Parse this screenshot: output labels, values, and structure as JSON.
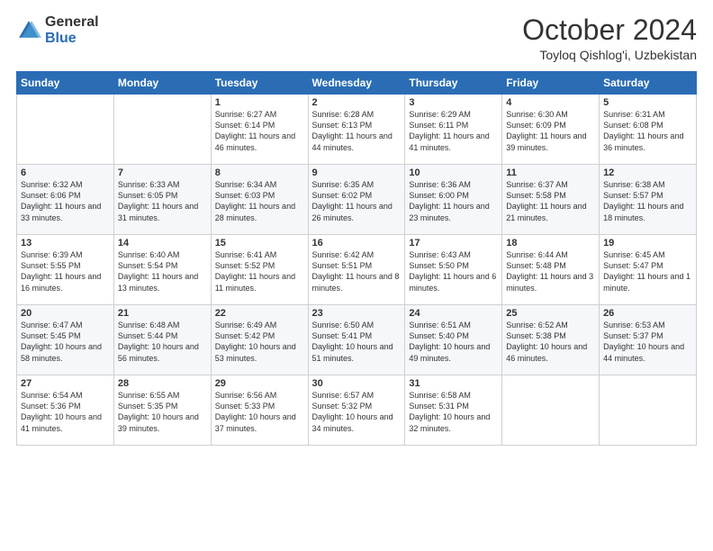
{
  "logo": {
    "general": "General",
    "blue": "Blue"
  },
  "header": {
    "month": "October 2024",
    "location": "Toyloq Qishlog'i, Uzbekistan"
  },
  "weekdays": [
    "Sunday",
    "Monday",
    "Tuesday",
    "Wednesday",
    "Thursday",
    "Friday",
    "Saturday"
  ],
  "weeks": [
    [
      null,
      null,
      {
        "day": 1,
        "sunrise": "6:27 AM",
        "sunset": "6:14 PM",
        "daylight": "11 hours and 46 minutes."
      },
      {
        "day": 2,
        "sunrise": "6:28 AM",
        "sunset": "6:13 PM",
        "daylight": "11 hours and 44 minutes."
      },
      {
        "day": 3,
        "sunrise": "6:29 AM",
        "sunset": "6:11 PM",
        "daylight": "11 hours and 41 minutes."
      },
      {
        "day": 4,
        "sunrise": "6:30 AM",
        "sunset": "6:09 PM",
        "daylight": "11 hours and 39 minutes."
      },
      {
        "day": 5,
        "sunrise": "6:31 AM",
        "sunset": "6:08 PM",
        "daylight": "11 hours and 36 minutes."
      }
    ],
    [
      {
        "day": 6,
        "sunrise": "6:32 AM",
        "sunset": "6:06 PM",
        "daylight": "11 hours and 33 minutes."
      },
      {
        "day": 7,
        "sunrise": "6:33 AM",
        "sunset": "6:05 PM",
        "daylight": "11 hours and 31 minutes."
      },
      {
        "day": 8,
        "sunrise": "6:34 AM",
        "sunset": "6:03 PM",
        "daylight": "11 hours and 28 minutes."
      },
      {
        "day": 9,
        "sunrise": "6:35 AM",
        "sunset": "6:02 PM",
        "daylight": "11 hours and 26 minutes."
      },
      {
        "day": 10,
        "sunrise": "6:36 AM",
        "sunset": "6:00 PM",
        "daylight": "11 hours and 23 minutes."
      },
      {
        "day": 11,
        "sunrise": "6:37 AM",
        "sunset": "5:58 PM",
        "daylight": "11 hours and 21 minutes."
      },
      {
        "day": 12,
        "sunrise": "6:38 AM",
        "sunset": "5:57 PM",
        "daylight": "11 hours and 18 minutes."
      }
    ],
    [
      {
        "day": 13,
        "sunrise": "6:39 AM",
        "sunset": "5:55 PM",
        "daylight": "11 hours and 16 minutes."
      },
      {
        "day": 14,
        "sunrise": "6:40 AM",
        "sunset": "5:54 PM",
        "daylight": "11 hours and 13 minutes."
      },
      {
        "day": 15,
        "sunrise": "6:41 AM",
        "sunset": "5:52 PM",
        "daylight": "11 hours and 11 minutes."
      },
      {
        "day": 16,
        "sunrise": "6:42 AM",
        "sunset": "5:51 PM",
        "daylight": "11 hours and 8 minutes."
      },
      {
        "day": 17,
        "sunrise": "6:43 AM",
        "sunset": "5:50 PM",
        "daylight": "11 hours and 6 minutes."
      },
      {
        "day": 18,
        "sunrise": "6:44 AM",
        "sunset": "5:48 PM",
        "daylight": "11 hours and 3 minutes."
      },
      {
        "day": 19,
        "sunrise": "6:45 AM",
        "sunset": "5:47 PM",
        "daylight": "11 hours and 1 minute."
      }
    ],
    [
      {
        "day": 20,
        "sunrise": "6:47 AM",
        "sunset": "5:45 PM",
        "daylight": "10 hours and 58 minutes."
      },
      {
        "day": 21,
        "sunrise": "6:48 AM",
        "sunset": "5:44 PM",
        "daylight": "10 hours and 56 minutes."
      },
      {
        "day": 22,
        "sunrise": "6:49 AM",
        "sunset": "5:42 PM",
        "daylight": "10 hours and 53 minutes."
      },
      {
        "day": 23,
        "sunrise": "6:50 AM",
        "sunset": "5:41 PM",
        "daylight": "10 hours and 51 minutes."
      },
      {
        "day": 24,
        "sunrise": "6:51 AM",
        "sunset": "5:40 PM",
        "daylight": "10 hours and 49 minutes."
      },
      {
        "day": 25,
        "sunrise": "6:52 AM",
        "sunset": "5:38 PM",
        "daylight": "10 hours and 46 minutes."
      },
      {
        "day": 26,
        "sunrise": "6:53 AM",
        "sunset": "5:37 PM",
        "daylight": "10 hours and 44 minutes."
      }
    ],
    [
      {
        "day": 27,
        "sunrise": "6:54 AM",
        "sunset": "5:36 PM",
        "daylight": "10 hours and 41 minutes."
      },
      {
        "day": 28,
        "sunrise": "6:55 AM",
        "sunset": "5:35 PM",
        "daylight": "10 hours and 39 minutes."
      },
      {
        "day": 29,
        "sunrise": "6:56 AM",
        "sunset": "5:33 PM",
        "daylight": "10 hours and 37 minutes."
      },
      {
        "day": 30,
        "sunrise": "6:57 AM",
        "sunset": "5:32 PM",
        "daylight": "10 hours and 34 minutes."
      },
      {
        "day": 31,
        "sunrise": "6:58 AM",
        "sunset": "5:31 PM",
        "daylight": "10 hours and 32 minutes."
      },
      null,
      null
    ]
  ]
}
